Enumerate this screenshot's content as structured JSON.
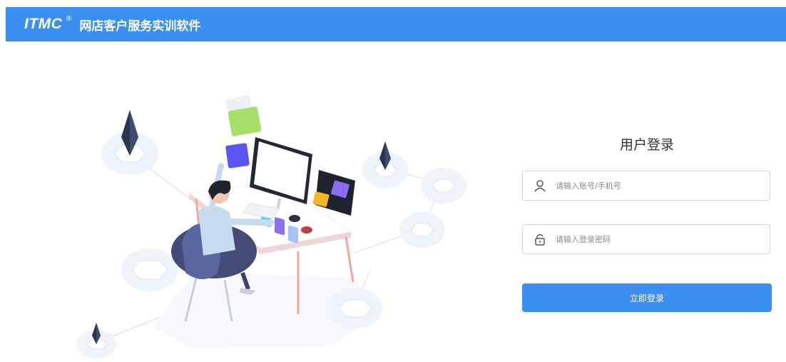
{
  "header": {
    "logo_text": "ITMC",
    "registered_mark": "®",
    "app_title": "网店客户服务实训软件",
    "background_color": "#3a8ff0"
  },
  "illustration": {
    "icon": "person-at-computer-illustration"
  },
  "login": {
    "title": "用户登录",
    "username_placeholder": "请输入账号/手机号",
    "username_value": "",
    "username_icon": "user-icon",
    "password_placeholder": "请输入登录密码",
    "password_value": "",
    "password_icon": "lock-icon",
    "submit_label": "立即登录",
    "accent_color": "#3a8ff0"
  }
}
